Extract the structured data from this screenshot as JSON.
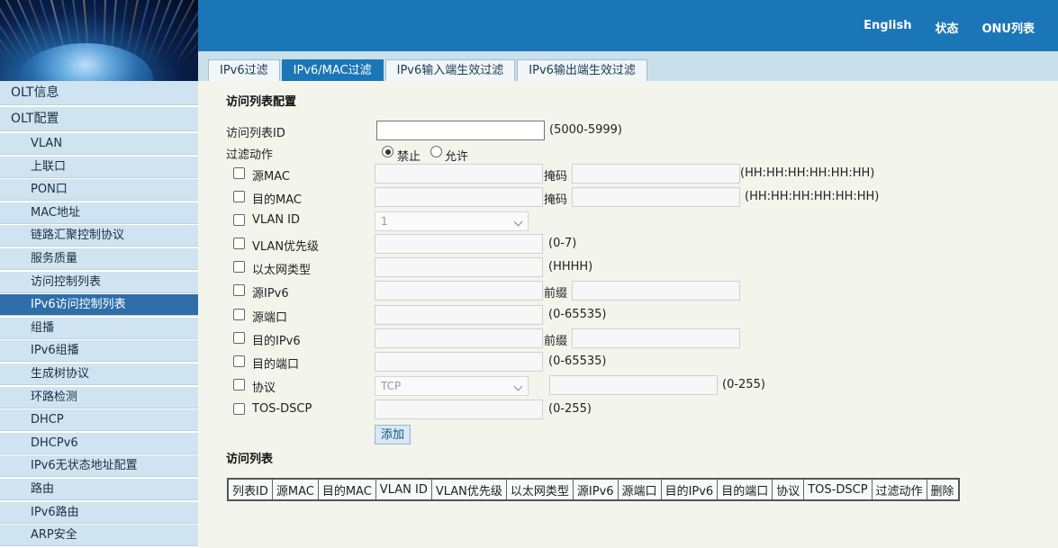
{
  "header": {
    "nav": [
      "English",
      "状态",
      "ONU列表"
    ]
  },
  "tabs": [
    {
      "label": "IPv6过滤",
      "active": false
    },
    {
      "label": "IPv6/MAC过滤",
      "active": true
    },
    {
      "label": "IPv6输入端生效过滤",
      "active": false
    },
    {
      "label": "IPv6输出端生效过滤",
      "active": false
    }
  ],
  "sidebar": {
    "top_items": [
      "OLT信息",
      "OLT配置"
    ],
    "sub_items": [
      "VLAN",
      "上联口",
      "PON口",
      "MAC地址",
      "链路汇聚控制协议",
      "服务质量",
      "访问控制列表",
      "IPv6访问控制列表",
      "组播",
      "IPv6组播",
      "生成树协议",
      "环路检测",
      "DHCP",
      "DHCPv6",
      "IPv6无状态地址配置",
      "路由",
      "IPv6路由",
      "ARP安全"
    ],
    "active_item": "IPv6访问控制列表"
  },
  "form": {
    "section_title": "访问列表配置",
    "acl_id_label": "访问列表ID",
    "acl_id_value": "",
    "acl_id_hint": "(5000-5999)",
    "action_label": "过滤动作",
    "action_deny": "禁止",
    "action_permit": "允许",
    "action_selected": "禁止",
    "src_mac": {
      "label": "源MAC",
      "mask_label": "掩码",
      "hint": "(HH:HH:HH:HH:HH:HH)"
    },
    "dst_mac": {
      "label": "目的MAC",
      "mask_label": "掩码",
      "hint": "(HH:HH:HH:HH:HH:HH)"
    },
    "vlan_id": {
      "label": "VLAN ID",
      "value": "1"
    },
    "vlan_priority": {
      "label": "VLAN优先级",
      "hint": "(0-7)"
    },
    "ether_type": {
      "label": "以太网类型",
      "hint": "(HHHH)"
    },
    "src_ipv6": {
      "label": "源IPv6",
      "prefix_label": "前缀"
    },
    "src_port": {
      "label": "源端口",
      "hint": "(0-65535)"
    },
    "dst_ipv6": {
      "label": "目的IPv6",
      "prefix_label": "前缀"
    },
    "dst_port": {
      "label": "目的端口",
      "hint": "(0-65535)"
    },
    "protocol": {
      "label": "协议",
      "value": "TCP",
      "hint": "(0-255)"
    },
    "tos_dscp": {
      "label": "TOS-DSCP",
      "hint": "(0-255)"
    },
    "add_button": "添加"
  },
  "acl_list": {
    "section_title": "访问列表",
    "columns": [
      "列表ID",
      "源MAC",
      "目的MAC",
      "VLAN ID",
      "VLAN优先级",
      "以太网类型",
      "源IPv6",
      "源端口",
      "目的IPv6",
      "目的端口",
      "协议",
      "TOS-DSCP",
      "过滤动作",
      "删除"
    ]
  },
  "colors": {
    "header_blue": "#1b76b8",
    "sidebar_active": "#2f6ea8",
    "content_bg": "#f3f5ec"
  }
}
